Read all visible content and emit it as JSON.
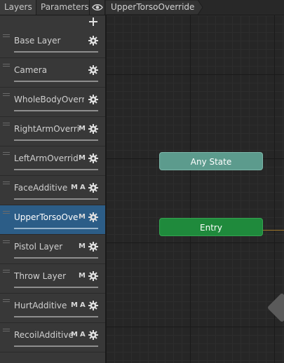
{
  "tabs": {
    "layers": "Layers",
    "parameters": "Parameters"
  },
  "breadcrumb": {
    "label": "UpperTorsoOverride"
  },
  "icons": {
    "eye": "eye-icon",
    "add": "plus-icon",
    "settings": "gear-icon",
    "drag": "drag-handle-icon"
  },
  "colors": {
    "selected": "#2c5d87",
    "any_state": "#5c9b8d",
    "entry": "#1f8a3c",
    "panel": "#383838"
  },
  "layers": [
    {
      "name": "Base Layer",
      "m": "",
      "a": "",
      "selected": false
    },
    {
      "name": "Camera",
      "m": "",
      "a": "",
      "selected": false
    },
    {
      "name": "WholeBodyOverri",
      "m": "",
      "a": "",
      "selected": false
    },
    {
      "name": "RightArmOverri",
      "m": "M",
      "a": "",
      "selected": false
    },
    {
      "name": "LeftArmOverrid",
      "m": "M",
      "a": "",
      "selected": false
    },
    {
      "name": "FaceAdditive",
      "m": "M",
      "a": "A",
      "selected": false
    },
    {
      "name": "UpperTorsoOve",
      "m": "M",
      "a": "",
      "selected": true
    },
    {
      "name": "Pistol Layer",
      "m": "M",
      "a": "",
      "selected": false
    },
    {
      "name": "Throw Layer",
      "m": "M",
      "a": "",
      "selected": false
    },
    {
      "name": "HurtAdditive",
      "m": "M",
      "a": "A",
      "selected": false
    },
    {
      "name": "RecoilAdditive",
      "m": "M",
      "a": "A",
      "selected": false
    }
  ],
  "graph": {
    "nodes": {
      "any_state": "Any State",
      "entry": "Entry"
    }
  }
}
